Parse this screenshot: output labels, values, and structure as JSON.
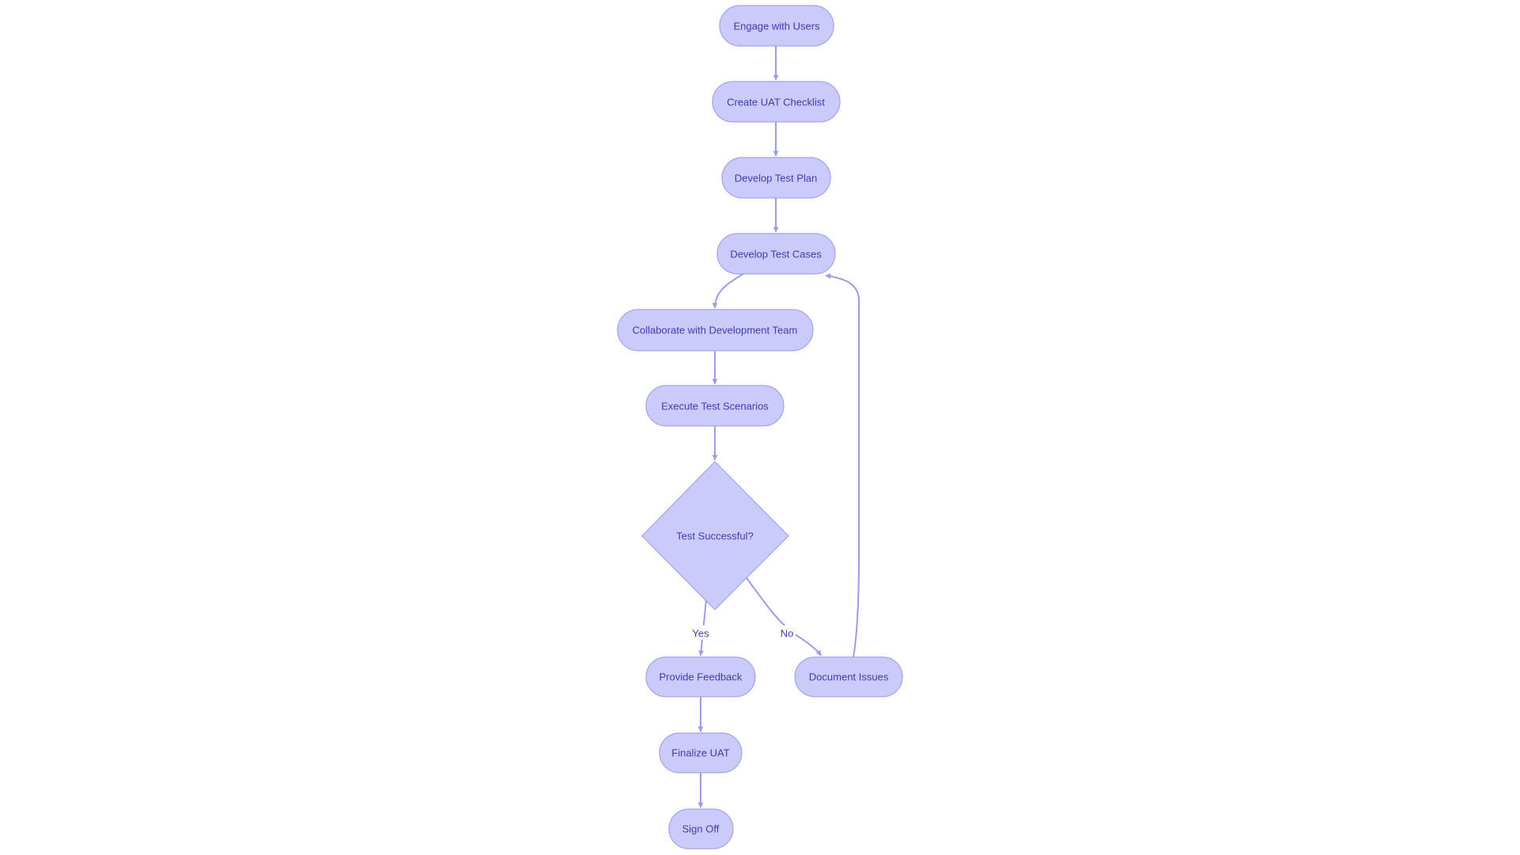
{
  "diagram": {
    "type": "flowchart",
    "direction": "top-down",
    "colors": {
      "node_fill": "#cbcbfb",
      "node_stroke": "#a3a3ea",
      "edge": "#9c9ce8",
      "text": "#3d3daf",
      "background": "#ffffff"
    },
    "nodes": [
      {
        "id": "engage",
        "label": "Engage with Users",
        "shape": "stadium"
      },
      {
        "id": "checklist",
        "label": "Create UAT Checklist",
        "shape": "stadium"
      },
      {
        "id": "plan",
        "label": "Develop Test Plan",
        "shape": "stadium"
      },
      {
        "id": "cases",
        "label": "Develop Test Cases",
        "shape": "stadium"
      },
      {
        "id": "collab",
        "label": "Collaborate with Development Team",
        "shape": "stadium"
      },
      {
        "id": "execute",
        "label": "Execute Test Scenarios",
        "shape": "stadium"
      },
      {
        "id": "decision",
        "label": "Test Successful?",
        "shape": "diamond"
      },
      {
        "id": "feedback",
        "label": "Provide Feedback",
        "shape": "stadium"
      },
      {
        "id": "issues",
        "label": "Document Issues",
        "shape": "stadium"
      },
      {
        "id": "finalize",
        "label": "Finalize UAT",
        "shape": "stadium"
      },
      {
        "id": "signoff",
        "label": "Sign Off",
        "shape": "stadium"
      }
    ],
    "edges": [
      {
        "from": "engage",
        "to": "checklist",
        "label": ""
      },
      {
        "from": "checklist",
        "to": "plan",
        "label": ""
      },
      {
        "from": "plan",
        "to": "cases",
        "label": ""
      },
      {
        "from": "cases",
        "to": "collab",
        "label": ""
      },
      {
        "from": "collab",
        "to": "execute",
        "label": ""
      },
      {
        "from": "execute",
        "to": "decision",
        "label": ""
      },
      {
        "from": "decision",
        "to": "feedback",
        "label": "Yes"
      },
      {
        "from": "decision",
        "to": "issues",
        "label": "No"
      },
      {
        "from": "issues",
        "to": "cases",
        "label": ""
      },
      {
        "from": "feedback",
        "to": "finalize",
        "label": ""
      },
      {
        "from": "finalize",
        "to": "signoff",
        "label": ""
      }
    ]
  }
}
